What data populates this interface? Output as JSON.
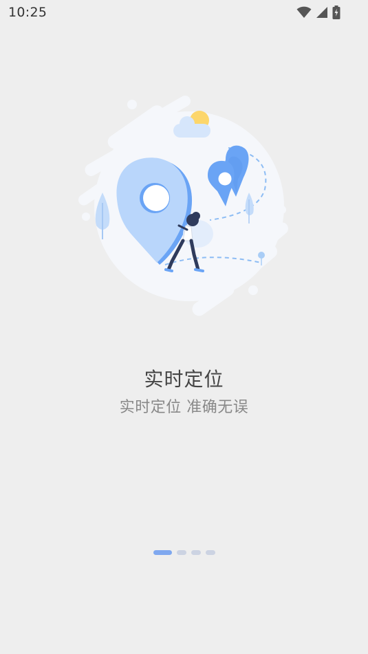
{
  "status_bar": {
    "time": "10:25",
    "icons": [
      "wifi-icon",
      "cellular-signal-icon",
      "battery-charging-icon"
    ]
  },
  "onboarding": {
    "illustration": "location-pins-illustration",
    "title": "实时定位",
    "subtitle": "实时定位 准确无误"
  },
  "pager": {
    "total_pages": 4,
    "current_page": 1
  },
  "colors": {
    "background": "#eeeeee",
    "accent": "#7fa8ef",
    "pin_blue": "#6aa4f5",
    "pin_light": "#b9d6fb",
    "dot_inactive": "#ccd3e2"
  }
}
